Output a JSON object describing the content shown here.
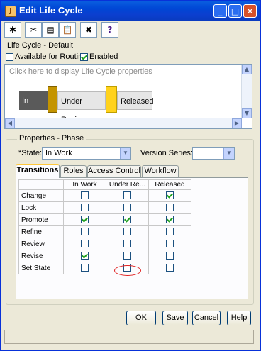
{
  "window": {
    "title": "Edit Life Cycle"
  },
  "toolbar": {
    "tools": [
      {
        "icon": "new-icon"
      },
      {
        "icon": "cut-icon"
      },
      {
        "icon": "copy-icon"
      },
      {
        "icon": "paste-icon"
      },
      {
        "icon": "delete-icon"
      },
      {
        "icon": "help-icon",
        "glyph": "?"
      }
    ]
  },
  "header": {
    "name": "Life Cycle - Default"
  },
  "options": {
    "routing_label": "Available for Routing",
    "routing_checked": false,
    "enabled_label": "Enabled",
    "enabled_checked": true
  },
  "lifecycle": {
    "hint": "Click here to display Life Cycle properties",
    "phases": [
      "In Work",
      "Under Review",
      "Released"
    ]
  },
  "properties": {
    "group_title": "Properties - Phase",
    "state_label": "*State:",
    "state_value": "In Work",
    "version_series_label": "Version Series:",
    "version_series_value": ""
  },
  "tabs": [
    "Transitions",
    "Roles",
    "Access Control",
    "Workflow"
  ],
  "transitions": {
    "columns": [
      "In Work",
      "Under Re...",
      "Released"
    ],
    "rows": [
      {
        "label": "Change",
        "values": [
          false,
          false,
          true
        ]
      },
      {
        "label": "Lock",
        "values": [
          false,
          false,
          false
        ]
      },
      {
        "label": "Promote",
        "values": [
          true,
          true,
          true
        ]
      },
      {
        "label": "Refine",
        "values": [
          false,
          false,
          false
        ]
      },
      {
        "label": "Review",
        "values": [
          false,
          false,
          false
        ]
      },
      {
        "label": "Revise",
        "values": [
          true,
          false,
          false
        ]
      },
      {
        "label": "Set State",
        "values": [
          false,
          false,
          false
        ]
      }
    ]
  },
  "buttons": {
    "ok": "OK",
    "save": "Save",
    "cancel": "Cancel",
    "help": "Help"
  },
  "colors": {
    "accent": "#0054e3",
    "phase_inwork": "#c49400",
    "phase_released": "#ffd21c",
    "annotation": "#e02020"
  }
}
